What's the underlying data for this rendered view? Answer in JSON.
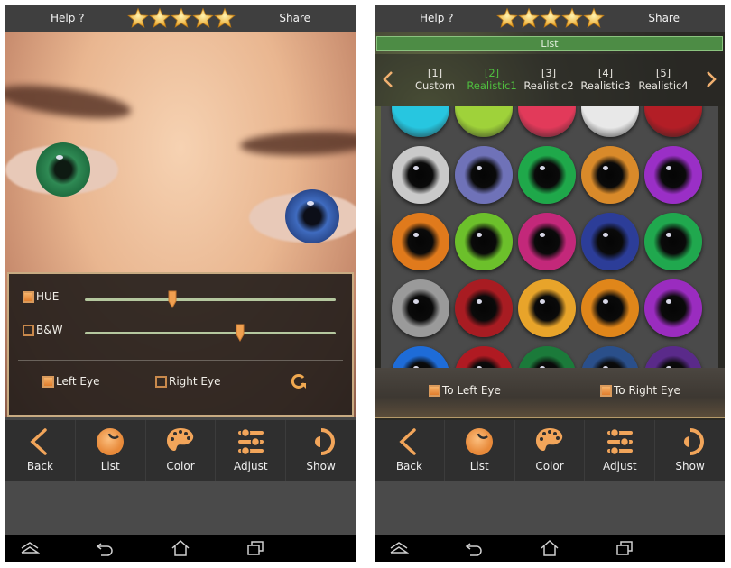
{
  "colors": {
    "accent_orange": "#f2a55a",
    "active_green": "#4fbf3f",
    "list_header_green": "#4d8c45",
    "topbar_bg": "#3f3f3f",
    "toolbar_bg": "#2f2f2f"
  },
  "left_screen": {
    "topbar": {
      "help_label": "Help ?",
      "share_label": "Share",
      "rating_stars": 5
    },
    "photo": {
      "description": "close-up face with recolored eyes",
      "left_eye_color": "green",
      "right_eye_color": "blue"
    },
    "adjust_panel": {
      "hue": {
        "label": "HUE",
        "checked": true,
        "value_fraction": 0.35
      },
      "bw": {
        "label": "B&W",
        "checked": false,
        "value_fraction": 0.62
      },
      "left_eye": {
        "label": "Left Eye",
        "checked": true
      },
      "right_eye": {
        "label": "Right Eye",
        "checked": false
      },
      "reset_icon": "refresh-icon"
    },
    "toolbar": [
      {
        "label": "Back",
        "icon": "chevron-left-icon"
      },
      {
        "label": "List",
        "icon": "eyeball-icon"
      },
      {
        "label": "Color",
        "icon": "palette-icon"
      },
      {
        "label": "Adjust",
        "icon": "sliders-icon"
      },
      {
        "label": "Show",
        "icon": "half-eye-icon"
      }
    ]
  },
  "right_screen": {
    "topbar": {
      "help_label": "Help ?",
      "share_label": "Share",
      "rating_stars": 5
    },
    "list_header": "List",
    "categories": [
      {
        "num": "[1]",
        "name": "Custom",
        "active": false
      },
      {
        "num": "[2]",
        "name": "Realistic1",
        "active": true
      },
      {
        "num": "[3]",
        "name": "Realistic2",
        "active": false
      },
      {
        "num": "[4]",
        "name": "Realistic3",
        "active": false
      },
      {
        "num": "[5]",
        "name": "Realistic4",
        "active": false
      }
    ],
    "eye_grid": [
      [
        "#27c6e0",
        "#9fd23a",
        "#e23a5a",
        "#e8e8e8",
        "#b31e26"
      ],
      [
        "#c9c9c9",
        "#6f72b8",
        "#1fa84a",
        "#d98a2a",
        "#9a2fc6"
      ],
      [
        "#e07a1c",
        "#6cc02b",
        "#c3287a",
        "#2c3d98",
        "#20a84e"
      ],
      [
        "#9a9a9a",
        "#a81c22",
        "#e8a42a",
        "#e0861a",
        "#9a2cbf"
      ],
      [
        "#1e6cd8",
        "#b01a22",
        "#1b7a3a",
        "#2a4f8a",
        "#5a2a8a"
      ]
    ],
    "apply": {
      "to_left": {
        "label": "To Left Eye",
        "checked": true
      },
      "to_right": {
        "label": "To Right Eye",
        "checked": true
      }
    },
    "toolbar": [
      {
        "label": "Back",
        "icon": "chevron-left-icon"
      },
      {
        "label": "List",
        "icon": "eyeball-icon"
      },
      {
        "label": "Color",
        "icon": "palette-icon"
      },
      {
        "label": "Adjust",
        "icon": "sliders-icon"
      },
      {
        "label": "Show",
        "icon": "half-eye-icon"
      }
    ]
  },
  "system_nav": [
    "collapse-icon",
    "back-icon",
    "home-icon",
    "recents-icon"
  ]
}
